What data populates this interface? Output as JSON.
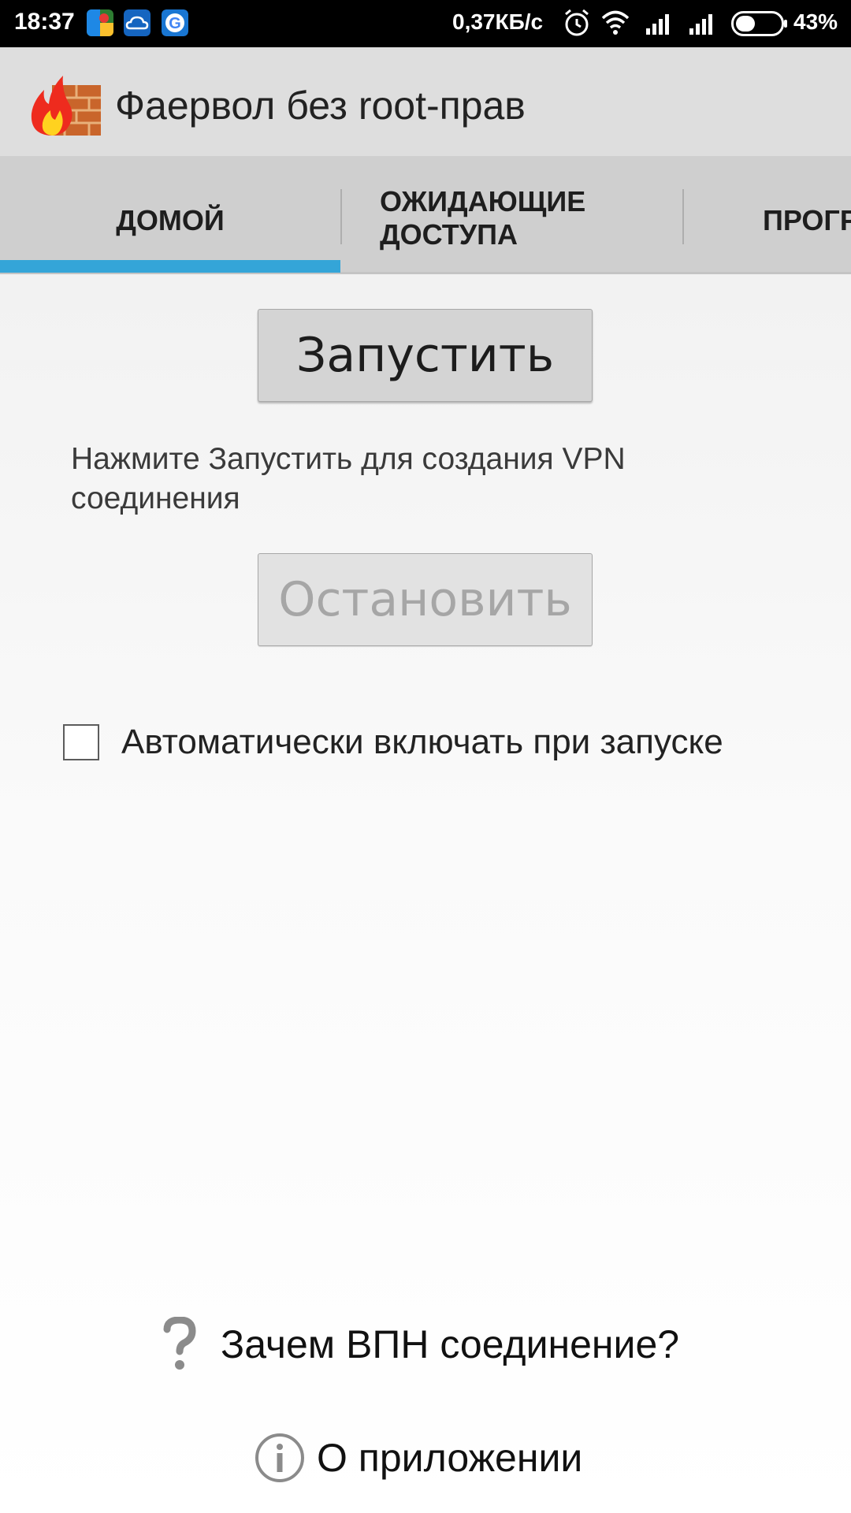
{
  "status_bar": {
    "time": "18:37",
    "network_speed": "0,37КБ/с",
    "battery_percent": "43%",
    "battery_level": 0.43,
    "icons": [
      "maps-icon",
      "cloud-icon",
      "google-icon",
      "alarm-icon",
      "wifi-icon",
      "signal-icon",
      "signal-icon-2",
      "battery-icon"
    ]
  },
  "app_bar": {
    "title": "Фаервол без root-прав",
    "logo_icon": "firewall-logo-icon"
  },
  "tabs": {
    "items": [
      {
        "label": "ДОМОЙ",
        "selected": true
      },
      {
        "label": "ОЖИДАЮЩИЕ ДОСТУПА",
        "selected": false
      },
      {
        "label": "ПРОГР",
        "selected": false
      }
    ],
    "indicator_color": "#34a5d8"
  },
  "main": {
    "start_button": "Запустить",
    "hint": "Нажмите Запустить для создания VPN соединения",
    "stop_button": "Остановить",
    "autostart_checkbox": {
      "label": "Автоматически включать при запуске",
      "checked": false
    }
  },
  "footer": {
    "why_vpn": "Зачем ВПН соединение?",
    "about": "О приложении"
  }
}
